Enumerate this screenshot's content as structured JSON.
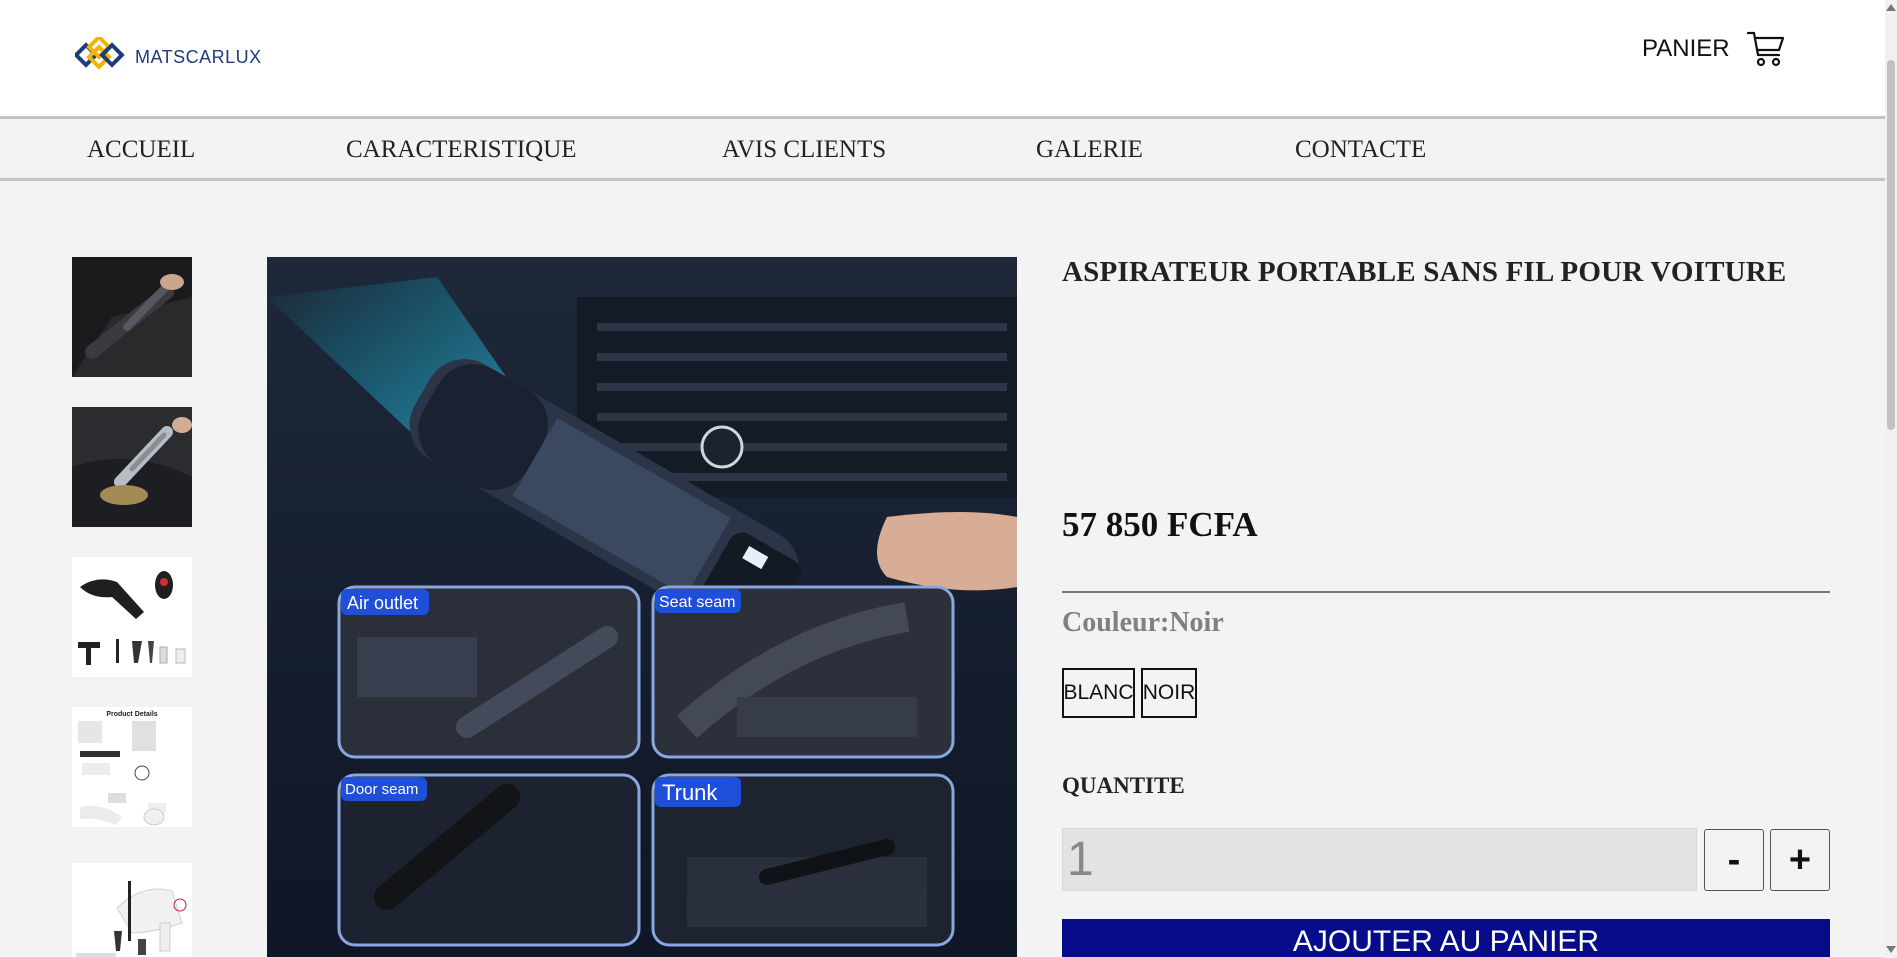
{
  "header": {
    "logo_text": "MATSCARLUX",
    "cart_label": "PANIER"
  },
  "nav": {
    "items": [
      {
        "label": "ACCUEIL"
      },
      {
        "label": "CARACTERISTIQUE"
      },
      {
        "label": "AVIS CLIENTS"
      },
      {
        "label": "GALERIE"
      },
      {
        "label": "CONTACTE"
      }
    ]
  },
  "gallery": {
    "main_image_labels": [
      "Air outlet",
      "Seat seam",
      "Door seam",
      "Trunk"
    ],
    "thumb_product_details_caption": "Product Details"
  },
  "product": {
    "title": "ASPIRATEUR PORTABLE SANS FIL POUR VOITURE",
    "price": "57 850 FCFA",
    "color_label": "Couleur:",
    "color_value": "Noir",
    "color_options": [
      "BLANC",
      "NOIR"
    ],
    "quantity_label": "QUANTITE",
    "quantity_value": "1",
    "minus_label": "-",
    "plus_label": "+",
    "add_to_cart_label": "AJOUTER AU PANIER"
  },
  "colors": {
    "brand_blue": "#1d3c7b",
    "logo_yellow": "#f2b400",
    "add_button": "#070c8b",
    "label_tag": "#1f4fd8"
  },
  "icons": {
    "logo": "diamond-logo-icon",
    "cart": "shopping-cart-icon"
  }
}
